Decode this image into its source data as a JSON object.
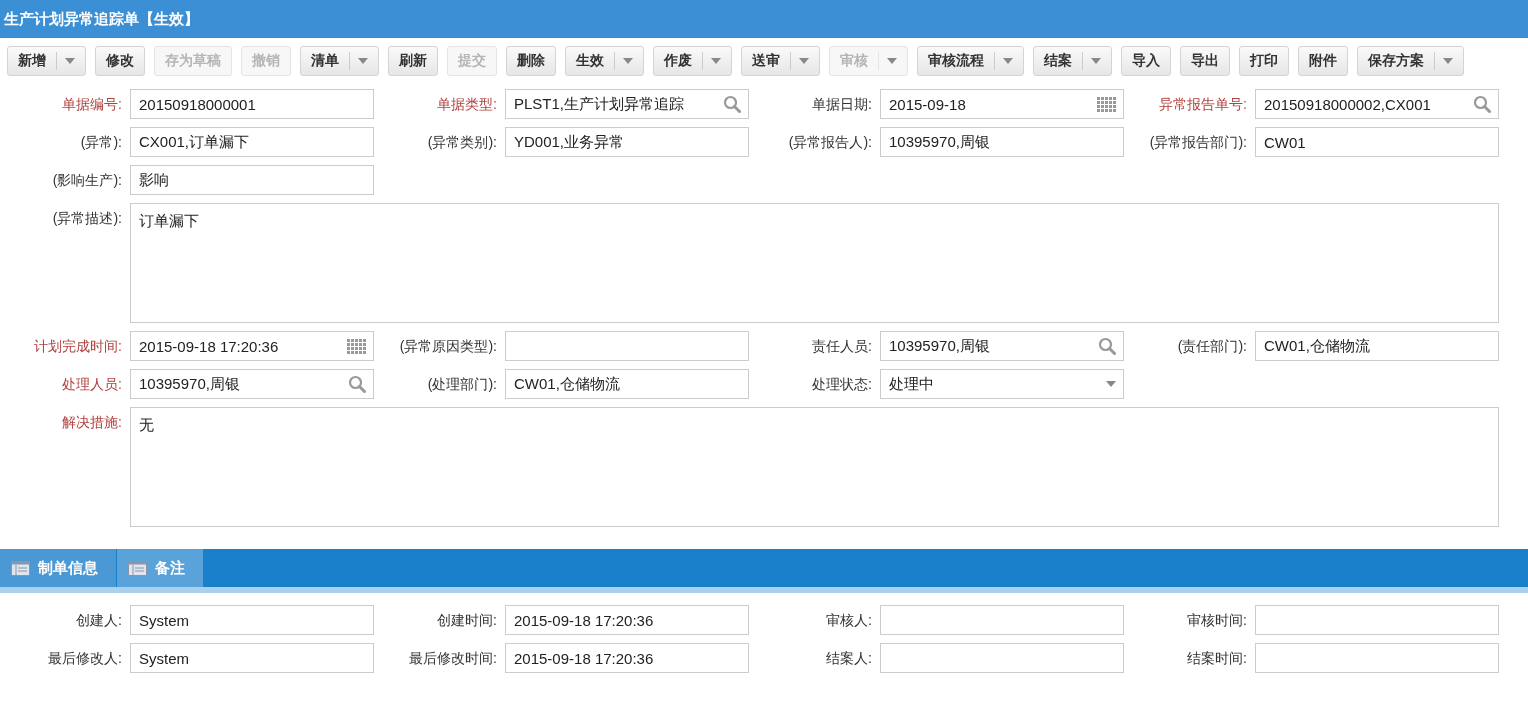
{
  "title": "生产计划异常追踪单【生效】",
  "toolbar": [
    {
      "label": "新增",
      "dropdown": true,
      "disabled": false
    },
    {
      "label": "修改",
      "dropdown": false,
      "disabled": false
    },
    {
      "label": "存为草稿",
      "dropdown": false,
      "disabled": true
    },
    {
      "label": "撤销",
      "dropdown": false,
      "disabled": true
    },
    {
      "label": "清单",
      "dropdown": true,
      "disabled": false
    },
    {
      "label": "刷新",
      "dropdown": false,
      "disabled": false
    },
    {
      "label": "提交",
      "dropdown": false,
      "disabled": true
    },
    {
      "label": "删除",
      "dropdown": false,
      "disabled": false
    },
    {
      "label": "生效",
      "dropdown": true,
      "disabled": false
    },
    {
      "label": "作废",
      "dropdown": true,
      "disabled": false
    },
    {
      "label": "送审",
      "dropdown": true,
      "disabled": false
    },
    {
      "label": "审核",
      "dropdown": true,
      "disabled": true
    },
    {
      "label": "审核流程",
      "dropdown": true,
      "disabled": false
    },
    {
      "label": "结案",
      "dropdown": true,
      "disabled": false
    },
    {
      "label": "导入",
      "dropdown": false,
      "disabled": false
    },
    {
      "label": "导出",
      "dropdown": false,
      "disabled": false
    },
    {
      "label": "打印",
      "dropdown": false,
      "disabled": false
    },
    {
      "label": "附件",
      "dropdown": false,
      "disabled": false
    },
    {
      "label": "保存方案",
      "dropdown": true,
      "disabled": false
    }
  ],
  "form_rows": [
    [
      {
        "label": "单据编号:",
        "value": "20150918000001",
        "kind": "text",
        "required": true
      },
      {
        "label": "单据类型:",
        "value": "PLST1,生产计划异常追踪",
        "kind": "lookup",
        "required": true
      },
      {
        "label": "单据日期:",
        "value": "2015-09-18",
        "kind": "date",
        "required": false
      },
      {
        "label": "异常报告单号:",
        "value": "20150918000002,CX001",
        "kind": "lookup",
        "required": true
      }
    ],
    [
      {
        "label": "(异常):",
        "value": "CX001,订单漏下",
        "kind": "text",
        "required": false
      },
      {
        "label": "(异常类别):",
        "value": "YD001,业务异常",
        "kind": "text",
        "required": false
      },
      {
        "label": "(异常报告人):",
        "value": "10395970,周银",
        "kind": "text",
        "required": false
      },
      {
        "label": "(异常报告部门):",
        "value": "CW01",
        "kind": "text",
        "required": false
      }
    ],
    [
      {
        "label": "(影响生产):",
        "value": "影响",
        "kind": "text",
        "required": false
      }
    ],
    [
      {
        "label": "(异常描述):",
        "value": "订单漏下",
        "kind": "textarea",
        "required": false
      }
    ],
    [
      {
        "label": "计划完成时间:",
        "value": "2015-09-18 17:20:36",
        "kind": "date",
        "required": true
      },
      {
        "label": "(异常原因类型):",
        "kind": "text",
        "required": false
      },
      {
        "label": "责任人员:",
        "value": "10395970,周银",
        "kind": "lookup",
        "required": false
      },
      {
        "label": "(责任部门):",
        "value": "CW01,仓储物流",
        "kind": "text",
        "required": false
      }
    ],
    [
      {
        "label": "处理人员:",
        "value": "10395970,周银",
        "kind": "lookup",
        "required": true
      },
      {
        "label": "(处理部门):",
        "value": "CW01,仓储物流",
        "kind": "text",
        "required": false
      },
      {
        "label": "处理状态:",
        "value": "处理中",
        "kind": "select",
        "required": false
      }
    ],
    [
      {
        "label": "解决措施:",
        "value": "无",
        "kind": "textarea",
        "required": true
      }
    ]
  ],
  "tabs": [
    {
      "label": "制单信息",
      "selected": true
    },
    {
      "label": "备注",
      "selected": false
    }
  ],
  "info_rows": [
    [
      {
        "label": "创建人:",
        "value": "System",
        "kind": "text",
        "required": false
      },
      {
        "label": "创建时间:",
        "value": "2015-09-18 17:20:36",
        "kind": "text",
        "required": false
      },
      {
        "label": "审核人:",
        "kind": "text",
        "required": false
      },
      {
        "label": "审核时间:",
        "kind": "text",
        "required": false
      }
    ],
    [
      {
        "label": "最后修改人:",
        "value": "System",
        "kind": "text",
        "required": false
      },
      {
        "label": "最后修改时间:",
        "value": "2015-09-18 17:20:36",
        "kind": "text",
        "required": false
      },
      {
        "label": "结案人:",
        "kind": "text",
        "required": false
      },
      {
        "label": "结案时间:",
        "kind": "text",
        "required": false
      }
    ]
  ]
}
